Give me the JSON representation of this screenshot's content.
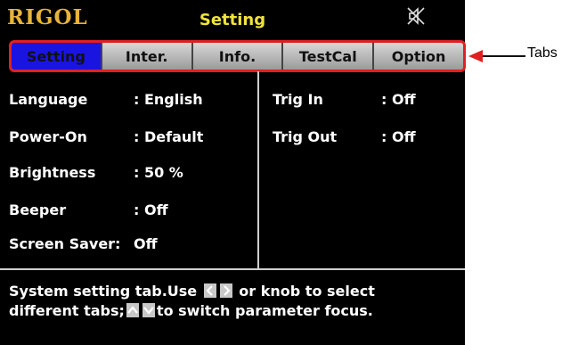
{
  "header": {
    "logo": "RIGOL",
    "title": "Setting",
    "mute_icon": "speaker-muted-icon"
  },
  "tabs": [
    {
      "label": "Setting",
      "active": true
    },
    {
      "label": "Inter.",
      "active": false
    },
    {
      "label": "Info.",
      "active": false
    },
    {
      "label": "TestCal",
      "active": false
    },
    {
      "label": "Option",
      "active": false
    }
  ],
  "settings_left": [
    {
      "label": "Language",
      "value": ": English"
    },
    {
      "label": "Power-On",
      "value": ": Default"
    },
    {
      "label": "Brightness",
      "value": ": 50 %"
    },
    {
      "label": "Beeper",
      "value": ": Off"
    },
    {
      "label": "Screen Saver:",
      "value": "Off"
    }
  ],
  "settings_right": [
    {
      "label": "Trig In",
      "value": ": Off"
    },
    {
      "label": "Trig Out",
      "value": ": Off"
    }
  ],
  "help": {
    "line1_a": "System setting tab.Use",
    "line1_b": "or knob to select",
    "line2_a": "different tabs;",
    "line2_b": "to switch parameter focus."
  },
  "annotation": {
    "label": "Tabs",
    "color": "#e02020"
  },
  "colors": {
    "active_tab": "#1a14e0",
    "title": "#f0e33b",
    "logo": "#e7b33a",
    "frame": "#e02020"
  }
}
